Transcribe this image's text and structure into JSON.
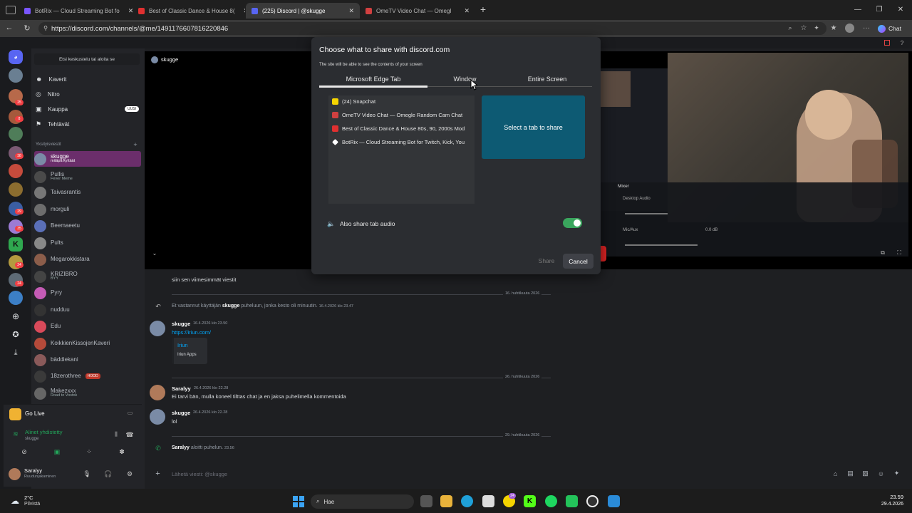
{
  "browser": {
    "tabs": [
      {
        "label": "BotRix — Cloud Streaming Bot fo",
        "color": "#7a56ff"
      },
      {
        "label": "Best of Classic Dance & House 8(",
        "color": "#e03030"
      },
      {
        "label": "(225) Discord | @skugge",
        "color": "#5865f2"
      },
      {
        "label": "OmeTV Video Chat — Omegl",
        "color": "#d14040"
      }
    ],
    "url": "https://discord.com/channels/@me/1491176607816220846",
    "chat_label": "Chat"
  },
  "discord": {
    "search_placeholder": "Etsi keskustelu tai aloita se",
    "nav": [
      {
        "label": "Kaverit"
      },
      {
        "label": "Nitro"
      },
      {
        "label": "Kauppa",
        "badge": "UUSI"
      },
      {
        "label": "Tehtävät"
      }
    ],
    "dm_header": "Yksityisviestit",
    "dms": [
      {
        "name": "skugge",
        "sub": "mitäpä kyttäät"
      },
      {
        "name": "Pullis",
        "sub": "Fever Meme"
      },
      {
        "name": "Taivasrantis",
        "sub": ""
      },
      {
        "name": "morguli",
        "sub": ""
      },
      {
        "name": "Beemaeetu",
        "sub": ""
      },
      {
        "name": "Pults",
        "sub": ""
      },
      {
        "name": "Megarokkistara",
        "sub": ""
      },
      {
        "name": "KRIZIBRO",
        "sub": "BYY"
      },
      {
        "name": "Pyry",
        "sub": ""
      },
      {
        "name": "nudduu",
        "sub": ""
      },
      {
        "name": "Edu",
        "sub": ""
      },
      {
        "name": "KoikkienKissojenKaveri",
        "sub": ""
      },
      {
        "name": "bäddiekani",
        "sub": ""
      },
      {
        "name": "18zerothree",
        "sub": "",
        "tag": "HOOD"
      },
      {
        "name": "Makezxxx",
        "sub": "Road to Vostok"
      }
    ],
    "golive": "Go Live",
    "voice_status": "Alinet yhdistetty",
    "voice_sub": "skugge",
    "user_name": "Saralyy",
    "user_status": "Ruudunjakaminen",
    "server_badges": [
      "25",
      "8",
      "38",
      "29",
      "35",
      "24",
      "24"
    ],
    "stage_user": "skugge",
    "messages": {
      "jump_text": "siin sen viimesimmät viestit",
      "date1": "16. huhtikuuta 2026",
      "missed_call": "Et vastannut käyttäjän",
      "missed_call_user": "skugge",
      "missed_call_rest": "puheluun, jonka kesto oli minuutin.",
      "missed_call_time": "16.4.2026 klo 23.47",
      "m1_author": "skugge",
      "m1_time": "16.4.2026 klo 23.50",
      "m1_text": "https://iriun.com/",
      "embed_title": "Iriun",
      "embed_sub": "Iriun Apps",
      "date2": "26. huhtikuuta 2026",
      "m2_author": "Saralyy",
      "m2_time": "26.4.2026 klo 22.28",
      "m2_text": "Ei tarvi bän, mulla koneel tilttas chat ja en jaksa puhelimella kommentoida",
      "m3_author": "skugge",
      "m3_time": "26.4.2026 klo 22.28",
      "m3_text": "lol",
      "date3": "29. huhtikuuta 2026",
      "call_user": "Saralyy",
      "call_text": "aloitti puhelun.",
      "call_time": "23.56",
      "input_placeholder": "Lähetä viesti: @skugge"
    },
    "obs": {
      "mixer": "Mixer",
      "desktop_audio": "Desktop Audio",
      "mic": "Mic/Aux",
      "db": "0.0 dB"
    }
  },
  "dialog": {
    "title": "Choose what to share with discord.com",
    "subtitle": "The site will be able to see the contents of your screen",
    "tabs": [
      "Microsoft Edge Tab",
      "Window",
      "Entire Screen"
    ],
    "items": [
      {
        "label": "(24) Snapchat",
        "color": "#f5d400"
      },
      {
        "label": "OmeTV Video Chat — Omegle Random Cam Chat",
        "color": "#d14040"
      },
      {
        "label": "Best of Classic Dance & House 80s, 90, 2000s Mod",
        "color": "#e03030"
      },
      {
        "label": "BotRix — Cloud Streaming Bot for Twitch, Kick, You",
        "color": "#ffffff"
      }
    ],
    "preview_text": "Select a tab to share",
    "audio_label": "Also share tab audio",
    "audio_enabled": true,
    "share_label": "Share",
    "cancel_label": "Cancel"
  },
  "taskbar": {
    "weather_temp": "2°C",
    "weather_desc": "Pilvistä",
    "search": "Hae",
    "time": "23.59",
    "date": "29.4.2026"
  }
}
